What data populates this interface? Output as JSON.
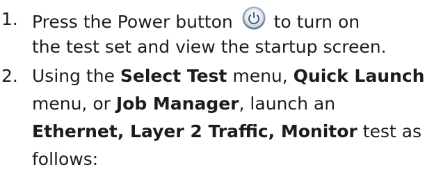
{
  "step1": {
    "number": "1.",
    "line1_before": "Press the Power button",
    "line1_after": "to turn on",
    "line2": "the test set and view the startup screen.",
    "icon": "power-icon"
  },
  "step2": {
    "number": "2.",
    "line1_a": "Using the ",
    "line1_b": "Select Test",
    "line1_c": " menu, ",
    "line1_d": "Quick Launch",
    "line2_a": "menu, or ",
    "line2_b": "Job Manager",
    "line2_c": ", launch an",
    "line3_a": "Ethernet",
    "line3_b": ", ",
    "line3_c": "Layer 2 Traffic, Monitor",
    "line3_d": " test as",
    "line4": "follows:"
  }
}
